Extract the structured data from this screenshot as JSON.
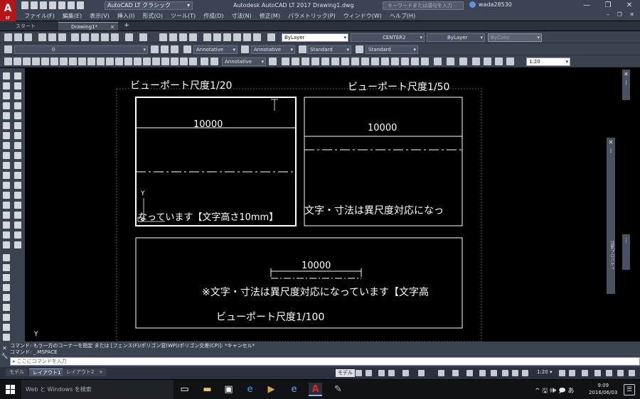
{
  "window": {
    "logo_letter": "A",
    "logo_sub": "LT",
    "workspace": "AutoCAD LT クラシック",
    "title": "Autodesk AutoCAD LT 2017    Drawing1.dwg",
    "search_placeholder": "キーワードまたは語句を入力",
    "username": "wada28530",
    "minimize": "—",
    "maximize": "❐",
    "close": "✕",
    "mdi_controls": "– ❐ ✕"
  },
  "menu": [
    "ファイル(F)",
    "編集(E)",
    "表示(V)",
    "挿入(I)",
    "形式(O)",
    "ツール(T)",
    "作成(D)",
    "寸法(N)",
    "修正(M)",
    "パラメトリック(P)",
    "ウィンドウ(W)",
    "ヘルプ(H)"
  ],
  "doc_tabs": {
    "start": "スタート",
    "drawing": "Drawing1*",
    "close": "×",
    "add": "+"
  },
  "toolbars": {
    "color": "ByLayer",
    "linetype": "CENTER2",
    "lineweight": "ByLayer",
    "plotstyle": "ByColor",
    "layer": "0",
    "text_anno": "Annotative",
    "dim_anno": "Annotative",
    "table_style": "Standard",
    "mleader_style": "Standard",
    "mleader_anno": "Annotative",
    "scale_value": "1:20"
  },
  "canvas": {
    "vp1_caption": "ビューポート尺度1/20",
    "vp2_caption": "ビューポート尺度1/50",
    "vp3_caption": "ビューポート尺度1/100",
    "dim_value": "10000",
    "vp1_text": "なっています【文字高さ10mm】",
    "vp2_text": "文字・寸法は異尺度対応になっ",
    "vp3_text": "※文字・寸法は異尺度対応になっています【文字高",
    "ucs_y": "Y",
    "ucs_y2": "Y"
  },
  "palettes": {
    "close": "✕",
    "properties_label": "注釈プロパティ"
  },
  "command": {
    "line1": "コマンド: もう一方のコーナーを指定 または [フェンス(F)/ポリゴン窓(WP)/ポリゴン交差(CP)]: *キャンセル*",
    "line2": "コマンド:  _.MSPACE",
    "placeholder": "ここにコマンドを入力",
    "prompt_icon": "▸",
    "close": "✕",
    "wrench": "🔧"
  },
  "layout_tabs": {
    "model": "モデル",
    "layout1": "レイアウト1",
    "layout2": "レイアウト2",
    "add": "+"
  },
  "status": {
    "model": "モデル",
    "scale": "1:20 ▾"
  },
  "taskbar": {
    "search": "Web と Windows を検索",
    "tray": "^ 🖫 🕪 🗩 あ",
    "time": "9:09",
    "date": "2016/06/03",
    "notif": "☰"
  },
  "colors": {
    "accent": "#b3151a",
    "canvas": "#000000",
    "ui_dark": "#3c4350"
  }
}
